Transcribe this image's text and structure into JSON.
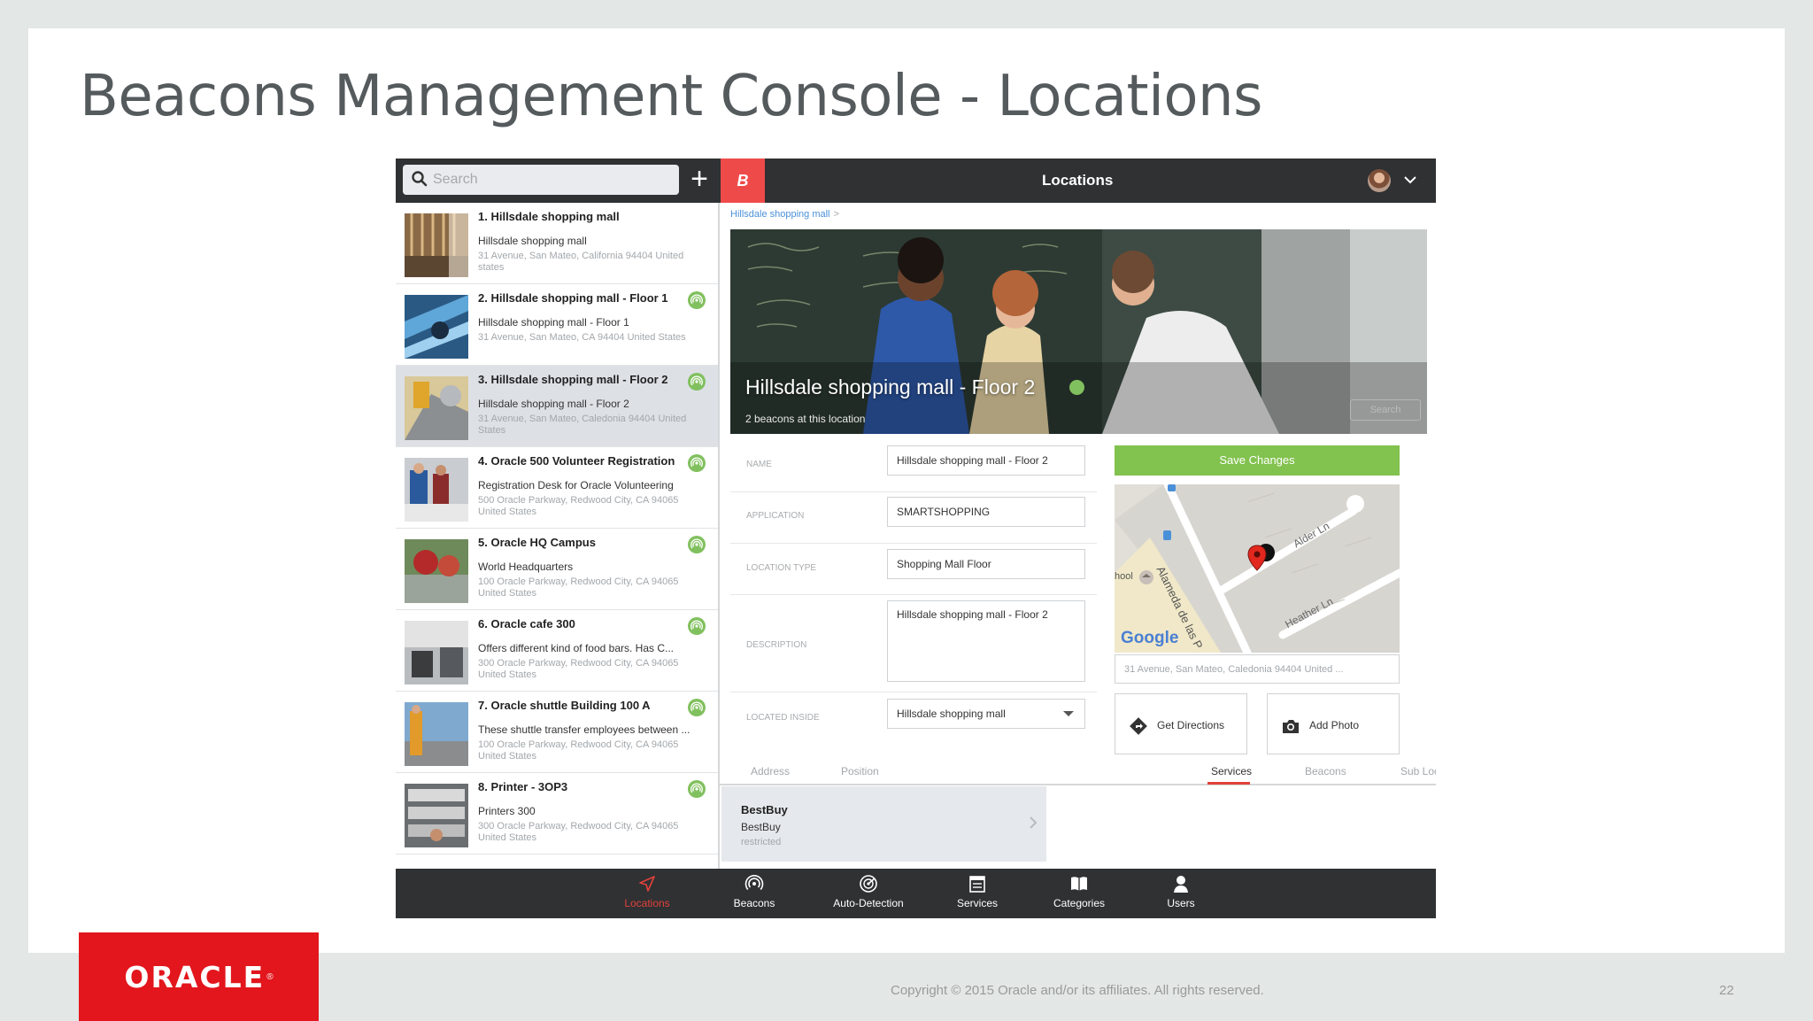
{
  "slide": {
    "title": "Beacons Management Console - Locations",
    "logo": "ORACLE",
    "copyright": "Copyright © 2015 Oracle and/or its affiliates. All rights reserved.",
    "page_number": "22"
  },
  "app": {
    "search": {
      "placeholder": "Search",
      "value": ""
    },
    "brand_letter": "B",
    "title": "Locations",
    "locations": [
      {
        "title": "1. Hillsdale shopping mall",
        "subtitle": "Hillsdale shopping mall",
        "address": "31 Avenue, San Mateo, California 94404 United states",
        "has_beacons": false
      },
      {
        "title": "2. Hillsdale shopping mall - Floor 1",
        "subtitle": "Hillsdale shopping mall - Floor 1",
        "address": "31 Avenue, San Mateo, CA 94404 United States",
        "has_beacons": true
      },
      {
        "title": "3. Hillsdale shopping mall - Floor 2",
        "subtitle": "Hillsdale shopping mall - Floor 2",
        "address": "31 Avenue, San Mateo, Caledonia 94404 United States",
        "has_beacons": true,
        "selected": true
      },
      {
        "title": "4. Oracle 500 Volunteer Registration",
        "subtitle": "Registration Desk for Oracle Volunteering",
        "address": "500 Oracle Parkway, Redwood City, CA 94065 United States",
        "has_beacons": true
      },
      {
        "title": "5. Oracle HQ Campus",
        "subtitle": "World Headquarters",
        "address": "100 Oracle Parkway, Redwood City, CA 94065 United States",
        "has_beacons": true
      },
      {
        "title": "6. Oracle cafe 300",
        "subtitle": "Offers different kind of food bars. Has C...",
        "address": "300 Oracle Parkway, Redwood City, CA 94065 United States",
        "has_beacons": true
      },
      {
        "title": "7. Oracle shuttle Building 100 A",
        "subtitle": "These shuttle transfer employees between ...",
        "address": "100 Oracle Parkway, Redwood City, CA 94065 United States",
        "has_beacons": true
      },
      {
        "title": "8. Printer - 3OP3",
        "subtitle": "Printers 300",
        "address": "300 Oracle Parkway, Redwood City, CA 94065 United States",
        "has_beacons": true
      }
    ],
    "detail": {
      "breadcrumb": "Hillsdale shopping mall",
      "breadcrumb_sep": ">",
      "hero_title": "Hillsdale shopping mall - Floor 2",
      "hero_count": "2 beacons at this location",
      "hero_button": "Search",
      "fields": {
        "name_label": "NAME",
        "name_value": "Hillsdale shopping mall - Floor 2",
        "application_label": "APPLICATION",
        "application_value": "SMARTSHOPPING",
        "type_label": "LOCATION TYPE",
        "type_value": "Shopping Mall Floor",
        "description_label": "DESCRIPTION",
        "description_value": "Hillsdale shopping mall - Floor 2",
        "inside_label": "LOCATED INSIDE",
        "inside_value": "Hillsdale shopping mall"
      },
      "save_label": "Save Changes",
      "map": {
        "streets": [
          "Alder Ln",
          "Heather Ln",
          "Alameda de las P"
        ],
        "poi": "hool",
        "provider": "Google"
      },
      "map_address": "31 Avenue, San Mateo, Caledonia 94404 United ...",
      "get_directions": "Get Directions",
      "add_photo": "Add Photo",
      "tabs": [
        "Address",
        "Position",
        "Services",
        "Beacons",
        "Sub Locations"
      ],
      "active_tab": "Services",
      "service": {
        "title": "BestBuy",
        "subtitle": "BestBuy",
        "status": "restricted"
      }
    },
    "bottom_nav": [
      {
        "label": "Locations",
        "icon": "location-arrow-icon",
        "active": true
      },
      {
        "label": "Beacons",
        "icon": "beacon-signal-icon"
      },
      {
        "label": "Auto-Detection",
        "icon": "radar-icon"
      },
      {
        "label": "Services",
        "icon": "services-icon"
      },
      {
        "label": "Categories",
        "icon": "book-icon"
      },
      {
        "label": "Users",
        "icon": "user-icon"
      }
    ],
    "colors": {
      "accent_red": "#e2413b",
      "save_green": "#82c24f",
      "beacon_green": "#81c05e",
      "topbar": "#2f3133"
    }
  }
}
